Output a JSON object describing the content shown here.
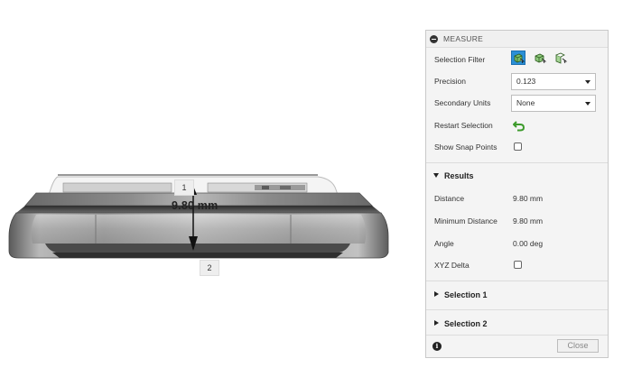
{
  "viewport": {
    "point_labels": [
      "1",
      "2"
    ],
    "dimension_text": "9.80 mm"
  },
  "panel": {
    "title": "MEASURE",
    "selection_filter": {
      "label": "Selection Filter",
      "icons": [
        "select-body-icon",
        "select-face-icon",
        "select-edge-icon"
      ]
    },
    "precision": {
      "label": "Precision",
      "value": "0.123"
    },
    "secondary_units": {
      "label": "Secondary Units",
      "value": "None"
    },
    "restart_selection": {
      "label": "Restart Selection",
      "icon": "restart-icon"
    },
    "show_snap_points": {
      "label": "Show Snap Points",
      "checked": false
    },
    "results": {
      "title": "Results",
      "distance": {
        "label": "Distance",
        "value": "9.80 mm"
      },
      "min_distance": {
        "label": "Minimum Distance",
        "value": "9.80 mm"
      },
      "angle": {
        "label": "Angle",
        "value": "0.00 deg"
      },
      "xyz_delta": {
        "label": "XYZ Delta",
        "checked": false
      }
    },
    "selection1": {
      "title": "Selection 1"
    },
    "selection2": {
      "title": "Selection 2"
    },
    "close_label": "Close",
    "info_icon": "info-icon"
  },
  "colors": {
    "accent": "#2a8fd6",
    "restart_green": "#3d9b2c"
  }
}
